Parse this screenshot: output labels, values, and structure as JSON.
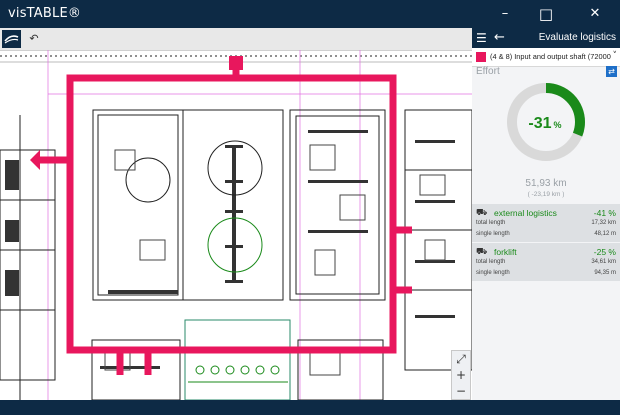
{
  "window": {
    "title": "visTABLE®",
    "minimize_glyph": "–",
    "maximize_glyph": "□",
    "close_glyph": "✕"
  },
  "toolbar": {
    "logo_icon": "vistable-logo-icon",
    "undo_icon": "undo-icon",
    "undo_glyph": "↶"
  },
  "zoom": {
    "fit_glyph": "⤢",
    "plus_glyph": "+",
    "minus_glyph": "−"
  },
  "panel": {
    "menu_glyph": "☰",
    "back_glyph": "←",
    "title": "Evaluate logistics",
    "selector_text": "(4 & 8) Input and output shaft (72000",
    "selector_color": "#e8175d",
    "selector_chevron": "˅",
    "effort_label": "Effort",
    "swap_glyph": "⇄",
    "donut": {
      "value_text": "-31",
      "unit": "%",
      "fraction": 0.31,
      "progress_color": "#1a8a1a",
      "track_color": "#d9d9d9"
    },
    "total_distance": "51,93 km",
    "total_delta": "( -23,19 km )",
    "categories": [
      {
        "icon": "truck-icon",
        "glyph": "⛟",
        "name": "external logistics",
        "percent": "-41 %",
        "label1": "total length",
        "value1": "17,32 km",
        "label2": "single length",
        "value2": "48,12 m"
      },
      {
        "icon": "forklift-icon",
        "glyph": "⛟",
        "name": "forklift",
        "percent": "-25 %",
        "label1": "total length",
        "value1": "34,61 km",
        "label2": "single length",
        "value2": "94,35 m"
      }
    ]
  },
  "colors": {
    "chrome": "#0d2a45",
    "route": "#e8175d",
    "accent_green": "#1a8a1a"
  }
}
